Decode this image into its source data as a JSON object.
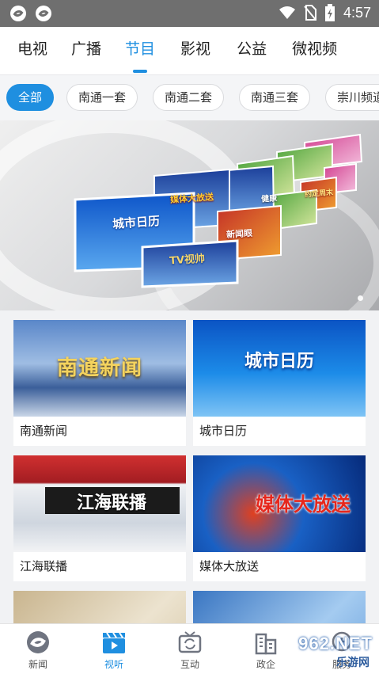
{
  "status_bar": {
    "time": "4:57",
    "left_icons": [
      "app-notification-icon",
      "app-notification-icon"
    ],
    "right_icons": [
      "wifi-icon",
      "no-sim-icon",
      "battery-charging-icon"
    ]
  },
  "top_tabs": [
    {
      "label": "电视",
      "active": false
    },
    {
      "label": "广播",
      "active": false
    },
    {
      "label": "节目",
      "active": true
    },
    {
      "label": "影视",
      "active": false
    },
    {
      "label": "公益",
      "active": false
    },
    {
      "label": "微视频",
      "active": false
    }
  ],
  "channel_chips": [
    {
      "label": "全部",
      "active": true
    },
    {
      "label": "南通一套",
      "active": false
    },
    {
      "label": "南通二套",
      "active": false
    },
    {
      "label": "南通三套",
      "active": false
    },
    {
      "label": "崇川频道",
      "active": false
    }
  ],
  "banner": {
    "thumb_texts": [
      "城市日历",
      "TV视帅",
      "媒体大放送",
      "新闻眼",
      "健康",
      "约定周末"
    ],
    "page_index": 1
  },
  "programs": [
    {
      "title": "南通新闻",
      "thumb_text": "南通新闻",
      "thumb_colors": [
        "#3a66b0",
        "#c7d6ea"
      ]
    },
    {
      "title": "城市日历",
      "thumb_text": "城市日历",
      "thumb_colors": [
        "#0e5fd0",
        "#8fc6f5"
      ]
    },
    {
      "title": "江海联播",
      "thumb_text": "江海联播",
      "thumb_colors": [
        "#b8282a",
        "#e9ecf0"
      ]
    },
    {
      "title": "媒体大放送",
      "thumb_text": "媒体大放送",
      "thumb_colors": [
        "#0a3d9a",
        "#e42b1f"
      ]
    },
    {
      "title": "",
      "thumb_text": "",
      "thumb_colors": [
        "#d8c9a8",
        "#e8dcc2"
      ]
    },
    {
      "title": "",
      "thumb_text": "",
      "thumb_colors": [
        "#3f7fcc",
        "#a8cdf2"
      ]
    }
  ],
  "bottom_nav": [
    {
      "label": "新闻",
      "icon": "news-logo-icon",
      "active": false
    },
    {
      "label": "视听",
      "icon": "clapperboard-icon",
      "active": true
    },
    {
      "label": "互动",
      "icon": "tv-interact-icon",
      "active": false
    },
    {
      "label": "政企",
      "icon": "building-icon",
      "active": false
    },
    {
      "label": "服务",
      "icon": "service-icon",
      "active": false
    }
  ],
  "watermark": {
    "text": "962.NET",
    "sub": "乐游网"
  },
  "colors": {
    "accent": "#1f8fe0",
    "status_bar": "#6f6f6f"
  }
}
